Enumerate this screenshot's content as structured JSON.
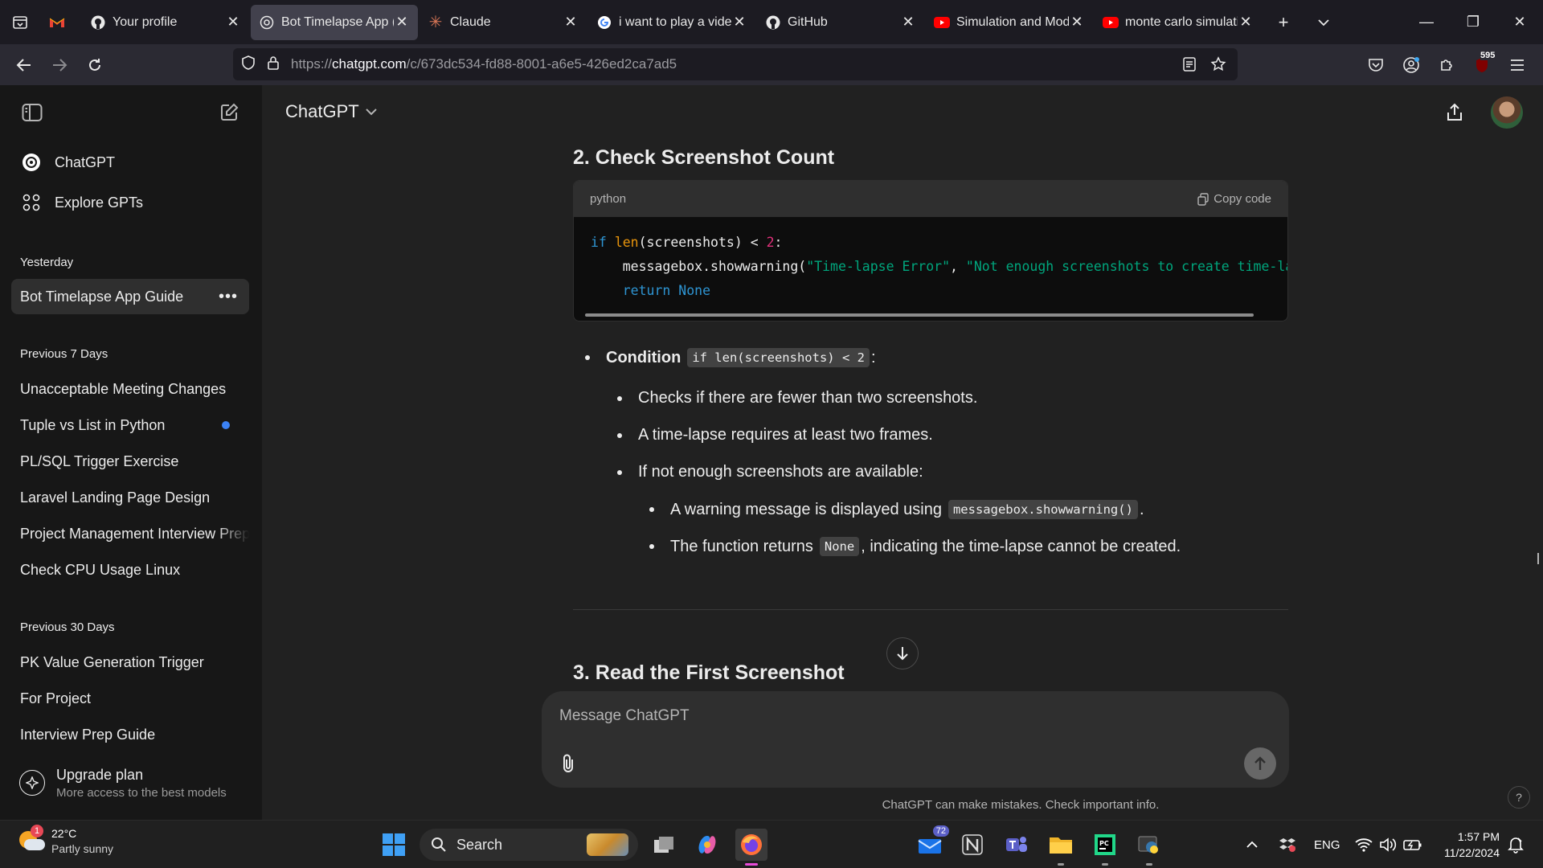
{
  "browser": {
    "tabs": [
      {
        "title": "",
        "icon": "gmail-icon",
        "type": "gmail"
      },
      {
        "title": "Your profile",
        "icon": "github-icon"
      },
      {
        "title": "Bot Timelapse App (",
        "icon": "chatgpt-icon",
        "active": true
      },
      {
        "title": "Claude",
        "icon": "claude-icon"
      },
      {
        "title": "i want to play a vide",
        "icon": "google-icon"
      },
      {
        "title": "GitHub",
        "icon": "github-icon"
      },
      {
        "title": "Simulation and Mod",
        "icon": "youtube-icon"
      },
      {
        "title": "monte carlo simulati",
        "icon": "youtube-icon"
      }
    ],
    "url_prefix": "https://",
    "url_domain": "chatgpt.com",
    "url_path": "/c/673dc534-fd88-8001-a6e5-426ed2ca7ad5",
    "ublock_count": "595"
  },
  "sidebar": {
    "nav": [
      {
        "label": "ChatGPT",
        "icon": "chatgpt-logo-icon"
      },
      {
        "label": "Explore GPTs",
        "icon": "grid-icon"
      }
    ],
    "sections": [
      {
        "title": "Yesterday",
        "items": [
          "Bot Timelapse App Guide"
        ]
      },
      {
        "title": "Previous 7 Days",
        "items": [
          "Unacceptable Meeting Changes",
          "Tuple vs List in Python",
          "PL/SQL Trigger Exercise",
          "Laravel Landing Page Design",
          "Project Management Interview Prep",
          "Check CPU Usage Linux"
        ]
      },
      {
        "title": "Previous 30 Days",
        "items": [
          "PK Value Generation Trigger",
          "For Project",
          "Interview Prep Guide"
        ]
      }
    ],
    "upgrade": {
      "title": "Upgrade plan",
      "subtitle": "More access to the best models"
    }
  },
  "main": {
    "model": "ChatGPT",
    "section2_title": "2. Check Screenshot Count",
    "code": {
      "language": "python",
      "copy_label": "Copy code",
      "line1": {
        "kw": "if",
        "fn": "len",
        "rest": "(screenshots) < ",
        "num": "2",
        "end": ":"
      },
      "line2": {
        "indent": "    ",
        "call": "messagebox.showwarning(",
        "s1": "\"Time-lapse Error\"",
        "sep": ", ",
        "s2": "\"Not enough screenshots to create time-lapse"
      },
      "line3": {
        "indent": "    ",
        "kw": "return",
        "val": "None"
      }
    },
    "bullets": {
      "condition_label": "Condition",
      "condition_code": "if len(screenshots) < 2",
      "condition_end": ":",
      "b1": "Checks if there are fewer than two screenshots.",
      "b2": "A time-lapse requires at least two frames.",
      "b3": "If not enough screenshots are available:",
      "b3a_pre": "A warning message is displayed using",
      "b3a_code": "messagebox.showwarning()",
      "b3a_end": ".",
      "b3b_pre": "The function returns",
      "b3b_code": "None",
      "b3b_end": ", indicating the time-lapse cannot be created."
    },
    "section3_title": "3. Read the First Screenshot",
    "composer_placeholder": "Message ChatGPT",
    "disclaimer": "ChatGPT can make mistakes. Check important info.",
    "help": "?"
  },
  "taskbar": {
    "weather_temp": "22°C",
    "weather_desc": "Partly sunny",
    "weather_badge": "1",
    "search_label": "Search",
    "mail_badge": "72",
    "lang": "ENG",
    "time": "1:57 PM",
    "date": "11/22/2024"
  }
}
